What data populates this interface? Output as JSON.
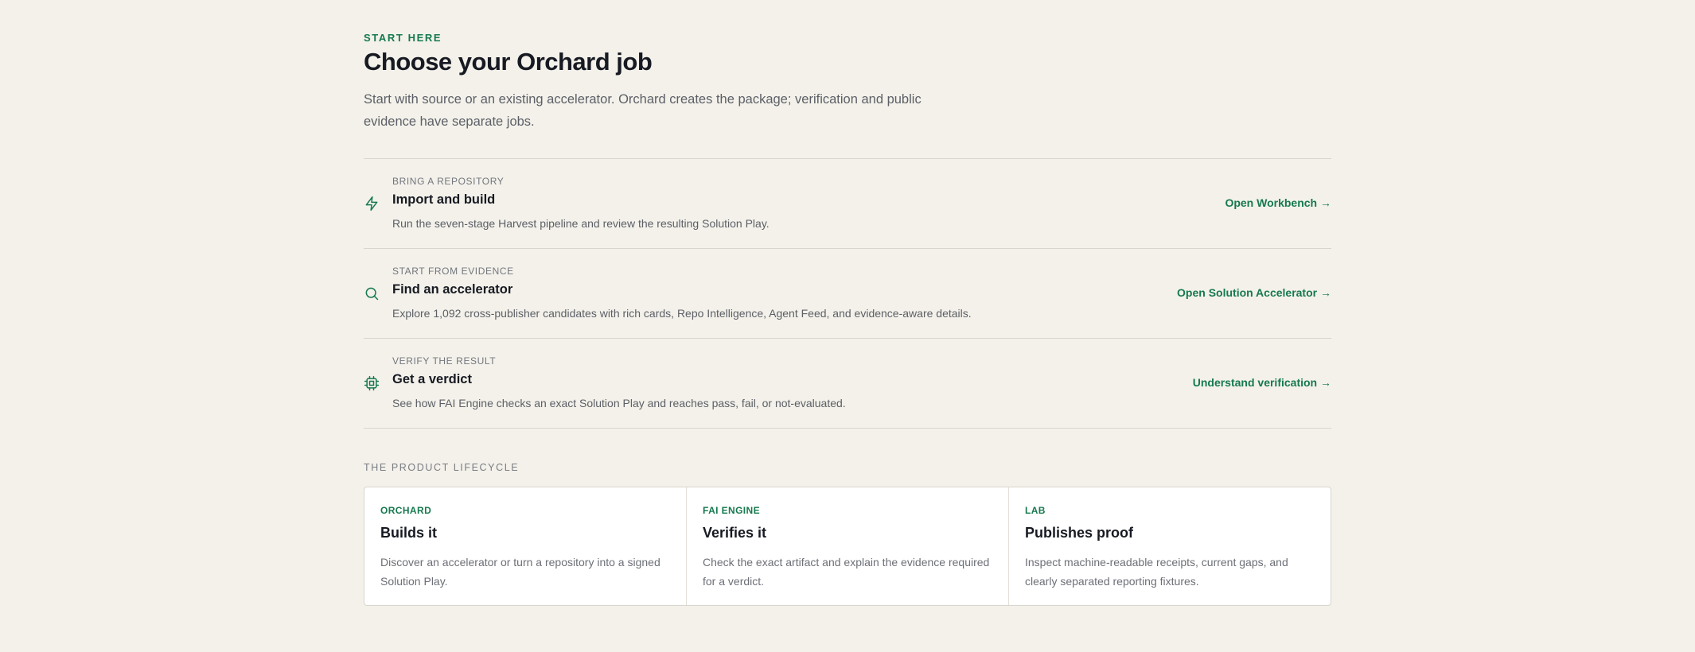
{
  "header": {
    "eyebrow": "START HERE",
    "title": "Choose your Orchard job",
    "intro": "Start with source or an existing accelerator. Orchard creates the package; verification and public evidence have separate jobs."
  },
  "jobs": [
    {
      "kicker": "BRING A REPOSITORY",
      "title": "Import and build",
      "description": "Run the seven-stage Harvest pipeline and review the resulting Solution Play.",
      "link": "Open Workbench →",
      "icon": "lightning-bolt-icon"
    },
    {
      "kicker": "START FROM EVIDENCE",
      "title": "Find an accelerator",
      "description": "Explore 1,092 cross-publisher candidates with rich cards, Repo Intelligence, Agent Feed, and evidence-aware details.",
      "link": "Open Solution Accelerator →",
      "icon": "search-icon"
    },
    {
      "kicker": "VERIFY THE RESULT",
      "title": "Get a verdict",
      "description": "See how FAI Engine checks an exact Solution Play and reaches pass, fail, or not-evaluated.",
      "link": "Understand verification →",
      "icon": "chip-icon"
    }
  ],
  "lifecycle": {
    "label": "THE PRODUCT LIFECYCLE",
    "stages": [
      {
        "kicker": "ORCHARD",
        "title": "Builds it",
        "description": "Discover an accelerator or turn a repository into a signed Solution Play."
      },
      {
        "kicker": "FAI ENGINE",
        "title": "Verifies it",
        "description": "Check the exact artifact and explain the evidence required for a verdict."
      },
      {
        "kicker": "LAB",
        "title": "Publishes proof",
        "description": "Inspect machine-readable receipts, current gaps, and clearly separated reporting fixtures."
      }
    ]
  },
  "colors": {
    "background": "#f3f1ea",
    "accent": "#16794f",
    "text": "#171a22",
    "muted": "#5c5f66",
    "divider": "#d8d5cc"
  }
}
